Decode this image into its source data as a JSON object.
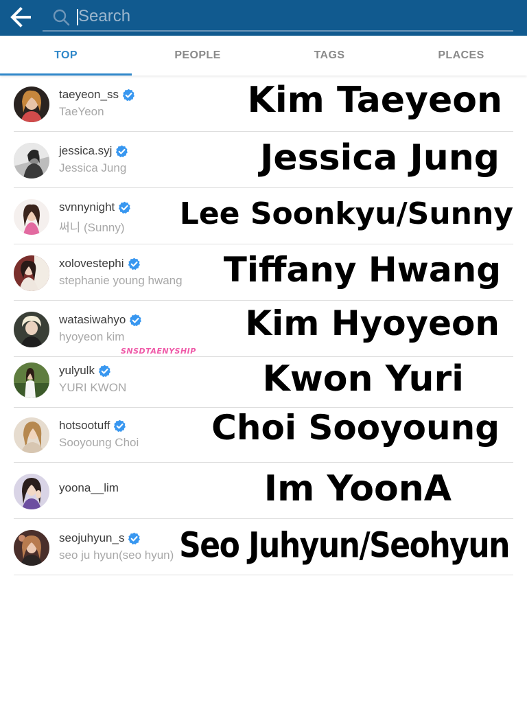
{
  "search": {
    "placeholder": "Search"
  },
  "tabs": [
    {
      "label": "TOP",
      "active": true
    },
    {
      "label": "PEOPLE",
      "active": false
    },
    {
      "label": "TAGS",
      "active": false
    },
    {
      "label": "PLACES",
      "active": false
    }
  ],
  "results": [
    {
      "handle": "taeyeon_ss",
      "verified": true,
      "fullname": "TaeYeon",
      "overlay": "Kim Taeyeon"
    },
    {
      "handle": "jessica.syj",
      "verified": true,
      "fullname": "Jessica Jung",
      "overlay": "Jessica Jung"
    },
    {
      "handle": "svnnynight",
      "verified": true,
      "fullname": "써니 (Sunny)",
      "overlay": "Lee Soonkyu/Sunny"
    },
    {
      "handle": "xolovestephi",
      "verified": true,
      "fullname": "stephanie young hwang",
      "overlay": "Tiffany Hwang"
    },
    {
      "handle": "watasiwahyo",
      "verified": true,
      "fullname": "hyoyeon kim",
      "overlay": "Kim Hyoyeon"
    },
    {
      "handle": "yulyulk",
      "verified": true,
      "fullname": "YURI KWON",
      "overlay": "Kwon Yuri"
    },
    {
      "handle": "hotsootuff",
      "verified": true,
      "fullname": "Sooyoung Choi",
      "overlay": "Choi Sooyoung"
    },
    {
      "handle": "yoona__lim",
      "verified": false,
      "fullname": "",
      "overlay": "Im YoonA"
    },
    {
      "handle": "seojuhyun_s",
      "verified": true,
      "fullname": "seo ju hyun(seo hyun)",
      "overlay": "Seo Juhyun/Seohyun"
    }
  ],
  "watermark": "SNSDTAENYSHIP",
  "colors": {
    "topbar": "#115a8f",
    "tab_active": "#2f87c9",
    "verified_badge": "#3897f0",
    "watermark": "#ef5aa8"
  },
  "icons": {
    "back": "arrow-left-icon",
    "search": "magnifier-icon",
    "verified": "verified-badge-icon"
  }
}
